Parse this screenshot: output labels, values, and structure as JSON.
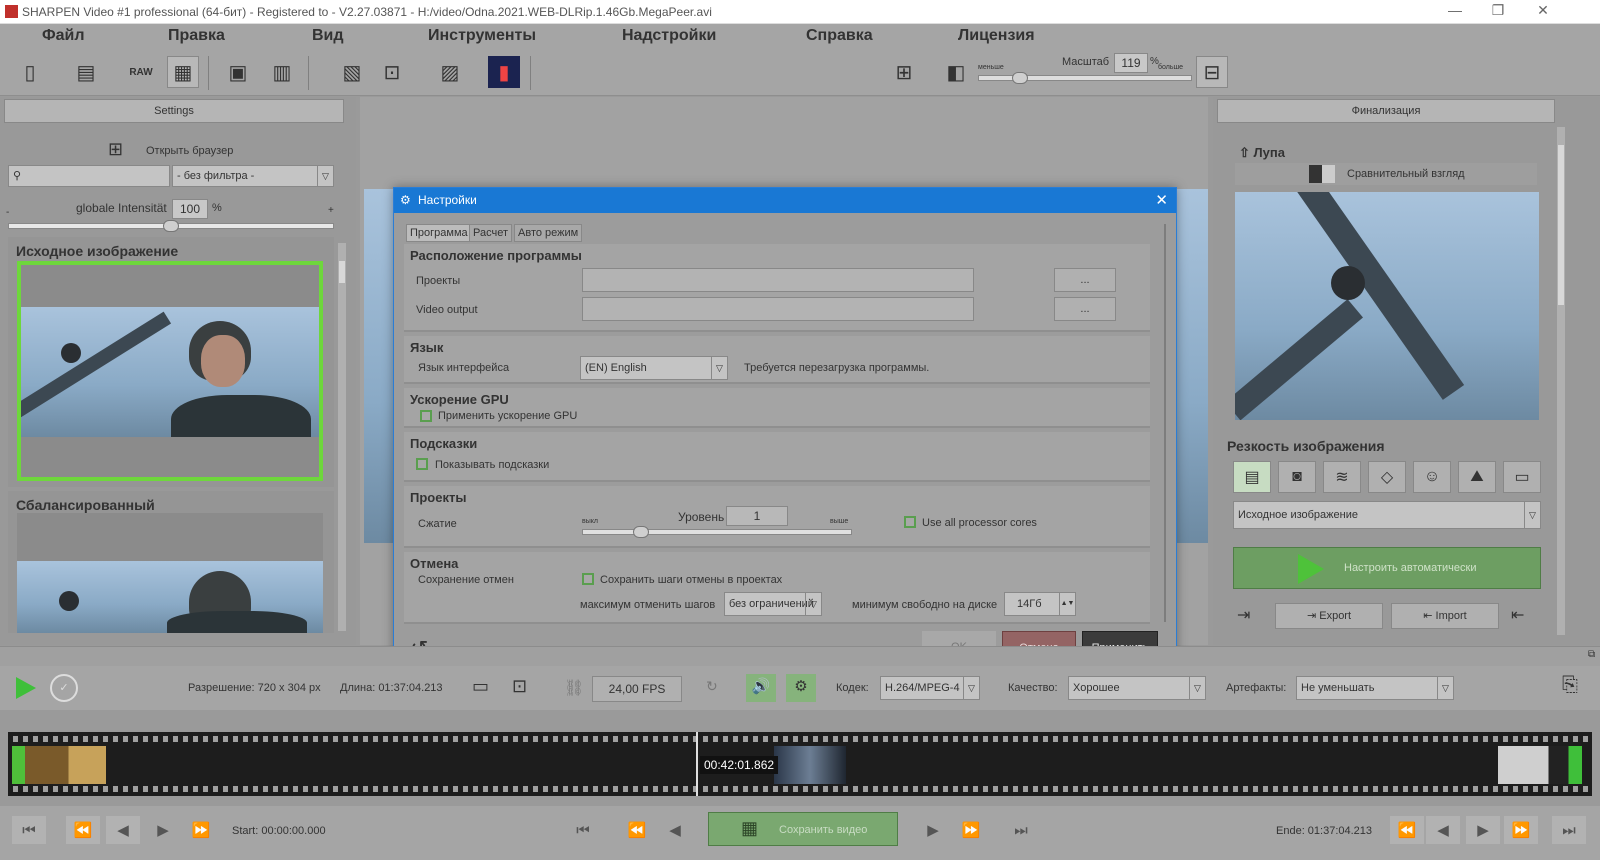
{
  "window": {
    "title": "SHARPEN Video #1 professional (64-бит) - Registered to - V2.27.03871 - H:/video/Odna.2021.WEB-DLRip.1.46Gb.MegaPeer.avi"
  },
  "menu": [
    "Файл",
    "Правка",
    "Вид",
    "Инструменты",
    "Надстройки",
    "Справка",
    "Лицензия"
  ],
  "toolbar": {
    "raw_label": "RAW",
    "scale_label": "Масштаб",
    "scale_value": "119",
    "scale_unit": "%",
    "smaller": "меньше",
    "bigger": "больше",
    "scale_level": 0.17
  },
  "left": {
    "header": "Settings",
    "browser_label": "Открыть браузер",
    "filter_value": "- без фильтра -",
    "intensity_label": "globale Intensität",
    "intensity_value": "100",
    "intensity_unit": "%",
    "minus": "-",
    "plus": "+",
    "intensity_level": 0.5,
    "section1": "Исходное изображение",
    "section2": "Сбалансированный"
  },
  "right": {
    "header": "Финализация",
    "loupe": "Лупа",
    "compare": "Сравнительный взгляд",
    "sharpness_title": "Резкость изображения",
    "source_select": "Исходное изображение",
    "auto_button": "Настроить автоматически",
    "export": "Export",
    "import": "Import"
  },
  "dialog": {
    "title": "Настройки",
    "tabs": [
      "Программа",
      "Расчет",
      "Авто режим"
    ],
    "location": {
      "title": "Расположение программы",
      "projects": "Проекты",
      "video_output": "Video output",
      "browse": "..."
    },
    "language": {
      "title": "Язык",
      "label": "Язык интерфейса",
      "value": "(EN) English",
      "note": "Требуется перезагрузка программы."
    },
    "gpu": {
      "title": "Ускорение GPU",
      "checkbox": "Применить ускорение GPU"
    },
    "hints": {
      "title": "Подсказки",
      "checkbox": "Показывать подсказки"
    },
    "projects": {
      "title": "Проекты",
      "compression": "Сжатие",
      "level_label": "Уровень",
      "level_value": "1",
      "off": "выкл",
      "higher": "выше",
      "cores": "Use all processor cores",
      "compression_level": 0.2
    },
    "undo": {
      "title": "Отмена",
      "save_label": "Сохранение отмен",
      "checkbox": "Сохранить шаги отмены в проектах",
      "max_steps_label": "максимум отменить шагов",
      "max_steps_value": "без ограничений",
      "min_free_label": "минимум свободно на диске",
      "min_free_value": "14Гб"
    },
    "ok": "OK",
    "cancel": "Отмена",
    "apply": "Применить"
  },
  "info": {
    "resolution": "Разрешение: 720 x 304 px",
    "length": "Длина: 01:37:04.213",
    "fps": "24,00 FPS",
    "codec_label": "Кодек:",
    "codec_value": "H.264/MPEG-4",
    "quality_label": "Качество:",
    "quality_value": "Хорошее",
    "artifacts_label": "Артефакты:",
    "artifacts_value": "Не уменьшать"
  },
  "timeline": {
    "marker": "00:42:01.862"
  },
  "transport": {
    "start": "Start: 00:00:00.000",
    "save_video": "Сохранить видео",
    "end": "Ende: 01:37:04.213"
  }
}
